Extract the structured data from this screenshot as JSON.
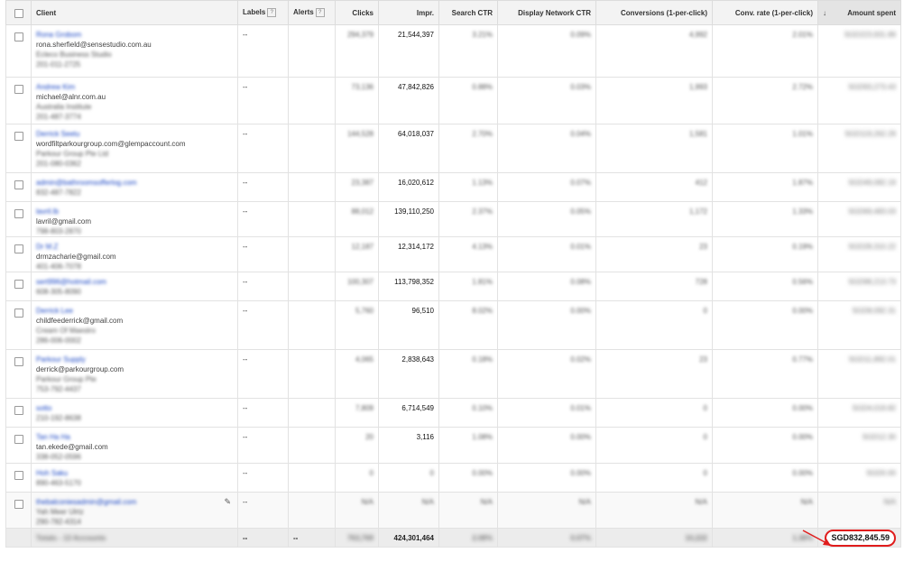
{
  "header": {
    "client": "Client",
    "labels": "Labels",
    "alerts": "Alerts",
    "help_glyph": "?",
    "clicks": "Clicks",
    "impr": "Impr.",
    "search_ctr": "Search CTR",
    "display_ctr": "Display Network CTR",
    "conversions": "Conversions (1-per-click)",
    "conv_rate": "Conv. rate (1-per-click)",
    "amount_spent": "Amount spent",
    "sort_glyph": "↓"
  },
  "rows": [
    {
      "name": "Rona Grobom",
      "email": "rona.sherfield@sensestudio.com.au",
      "company": "Ecleco Business Studio",
      "phone": "201-011-2725",
      "labels": "--",
      "clicks": "294,379",
      "impr": "21,544,397",
      "search_ctr": "3.21%",
      "display_ctr": "0.09%",
      "conversions": "4,992",
      "conv_rate": "2.01%",
      "amount": "SGD223,931.89"
    },
    {
      "name": "Andrew Kim",
      "email": "michael@alnr.com.au",
      "company": "Australia Institute",
      "phone": "201-487-3774",
      "labels": "--",
      "clicks": "73,136",
      "impr": "47,842,826",
      "search_ctr": "0.88%",
      "display_ctr": "0.03%",
      "conversions": "1,993",
      "conv_rate": "2.72%",
      "amount": "SGD93,273.43"
    },
    {
      "name": "Derrick Seetu",
      "email": "wordfiltparkourgroup.com@glempaccount.com",
      "company": "Parkour Group Pte Ltd",
      "phone": "201-080-0362",
      "labels": "--",
      "clicks": "144,528",
      "impr": "64,018,037",
      "search_ctr": "2.70%",
      "display_ctr": "0.04%",
      "conversions": "1,581",
      "conv_rate": "1.01%",
      "amount": "SGD119,262.29"
    },
    {
      "name": "admin@bathroomsofferlog.com",
      "email": "",
      "company": "",
      "phone": "832-487-7822",
      "labels": "--",
      "clicks": "23,387",
      "impr": "16,020,612",
      "search_ctr": "1.13%",
      "display_ctr": "0.07%",
      "conversions": "412",
      "conv_rate": "1.87%",
      "amount": "SGD49,082.19"
    },
    {
      "name": "lavril.lb",
      "email": "lavril@gmail.com",
      "company": "",
      "phone": "798-803-2870",
      "labels": "--",
      "clicks": "88,012",
      "impr": "139,110,250",
      "search_ctr": "2.37%",
      "display_ctr": "0.05%",
      "conversions": "1,172",
      "conv_rate": "1.33%",
      "amount": "SGD69,483.03"
    },
    {
      "name": "Dr M.Z",
      "email": "drmzacharie@gmail.com",
      "company": "",
      "phone": "401-406-7078",
      "labels": "--",
      "clicks": "12,187",
      "impr": "12,314,172",
      "search_ctr": "4.13%",
      "display_ctr": "0.01%",
      "conversions": "23",
      "conv_rate": "0.19%",
      "amount": "SGD28,310.22"
    },
    {
      "name": "sert996@hotmail.com",
      "email": "",
      "company": "",
      "phone": "608-305-8090",
      "labels": "--",
      "clicks": "100,307",
      "impr": "113,798,352",
      "search_ctr": "1.81%",
      "display_ctr": "0.08%",
      "conversions": "728",
      "conv_rate": "0.56%",
      "amount": "SGD98,213.73"
    },
    {
      "name": "Derrick Lee",
      "email": "childfeederrick@gmail.com",
      "company": "Cream Of Maestro",
      "phone": "286-006-0002",
      "labels": "--",
      "clicks": "5,760",
      "impr": "96,510",
      "search_ctr": "8.02%",
      "display_ctr": "0.00%",
      "conversions": "0",
      "conv_rate": "0.00%",
      "amount": "SGD8,092.31"
    },
    {
      "name": "Parkour Supply",
      "email": "derrick@parkourgroup.com",
      "company": "Parkour Group Pte",
      "phone": "753-792-4437",
      "labels": "--",
      "clicks": "4,065",
      "impr": "2,838,643",
      "search_ctr": "0.18%",
      "display_ctr": "0.02%",
      "conversions": "23",
      "conv_rate": "0.77%",
      "amount": "SGD11,892.01"
    },
    {
      "name": "sotto",
      "email": "",
      "company": "",
      "phone": "210-192-8638",
      "labels": "--",
      "clicks": "7,809",
      "impr": "6,714,549",
      "search_ctr": "0.10%",
      "display_ctr": "0.01%",
      "conversions": "0",
      "conv_rate": "0.00%",
      "amount": "SGD4,019.82"
    },
    {
      "name": "Tan Ha Ha",
      "email": "tan.ekede@gmail.com",
      "company": "",
      "phone": "338-052-0596",
      "labels": "--",
      "clicks": "20",
      "impr": "3,116",
      "search_ctr": "1.08%",
      "display_ctr": "0.00%",
      "conversions": "0",
      "conv_rate": "0.00%",
      "amount": "SGD12.30"
    },
    {
      "name": "Hoh Saku",
      "email": "",
      "company": "",
      "phone": "890-463-5170",
      "labels": "--",
      "clicks": "0",
      "impr": "0",
      "search_ctr": "0.00%",
      "display_ctr": "0.00%",
      "conversions": "0",
      "conv_rate": "0.00%",
      "amount": "SGD0.00"
    },
    {
      "name": "thebalconiesadmin@gmail.com",
      "email": "",
      "company": "Yah Meer Ulrtz",
      "phone": "290-782-4314",
      "labels": "--",
      "clicks": "N/A",
      "impr": "N/A",
      "search_ctr": "N/A",
      "display_ctr": "N/A",
      "conversions": "N/A",
      "conv_rate": "N/A",
      "amount": "N/A"
    }
  ],
  "total": {
    "label": "Totals - 13 Accounts",
    "labels": "--",
    "alerts": "--",
    "clicks": "763,769",
    "impr": "424,301,464",
    "search_ctr": "2.08%",
    "display_ctr": "0.07%",
    "conversions": "10,222",
    "conv_rate": "1.38%",
    "amount": "SGD832,845.59"
  },
  "colors": {
    "link": "#1a46c4",
    "highlight": "#e01c1c",
    "header_bg": "#f3f3f3",
    "total_bg": "#ececec"
  },
  "icons": {
    "edit": "pencil-icon",
    "pointer": "red-arrow-icon"
  }
}
